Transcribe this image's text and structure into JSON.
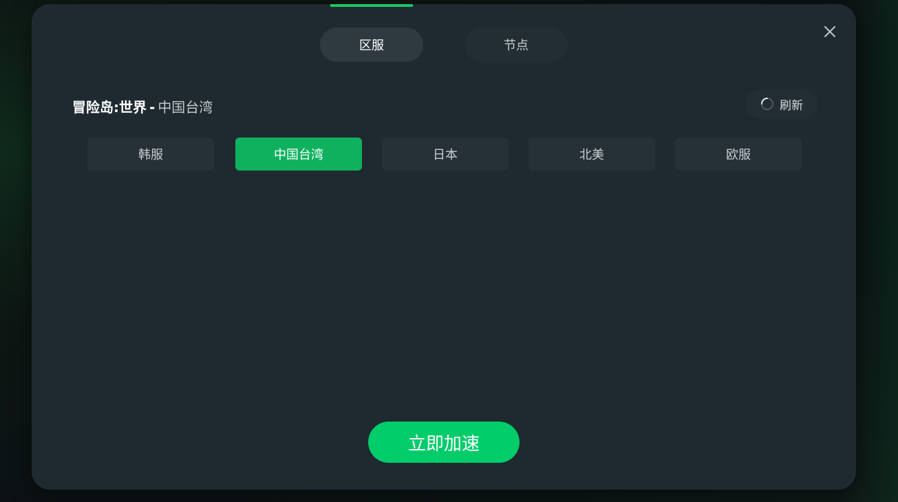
{
  "tabs": [
    {
      "label": "区服",
      "active": true
    },
    {
      "label": "节点",
      "active": false
    }
  ],
  "header": {
    "game": "冒险岛:世界",
    "separator": "-",
    "region": "中国台湾"
  },
  "refresh_label": "刷新",
  "servers": [
    {
      "label": "韩服",
      "selected": false
    },
    {
      "label": "中国台湾",
      "selected": true
    },
    {
      "label": "日本",
      "selected": false
    },
    {
      "label": "北美",
      "selected": false
    },
    {
      "label": "欧服",
      "selected": false
    }
  ],
  "accelerate_label": "立即加速",
  "icons": {
    "close": "close-icon",
    "refresh": "refresh-icon"
  },
  "colors": {
    "accent": "#00cc6a",
    "selected": "#0fb15f",
    "modal_bg": "#1f2a30"
  }
}
